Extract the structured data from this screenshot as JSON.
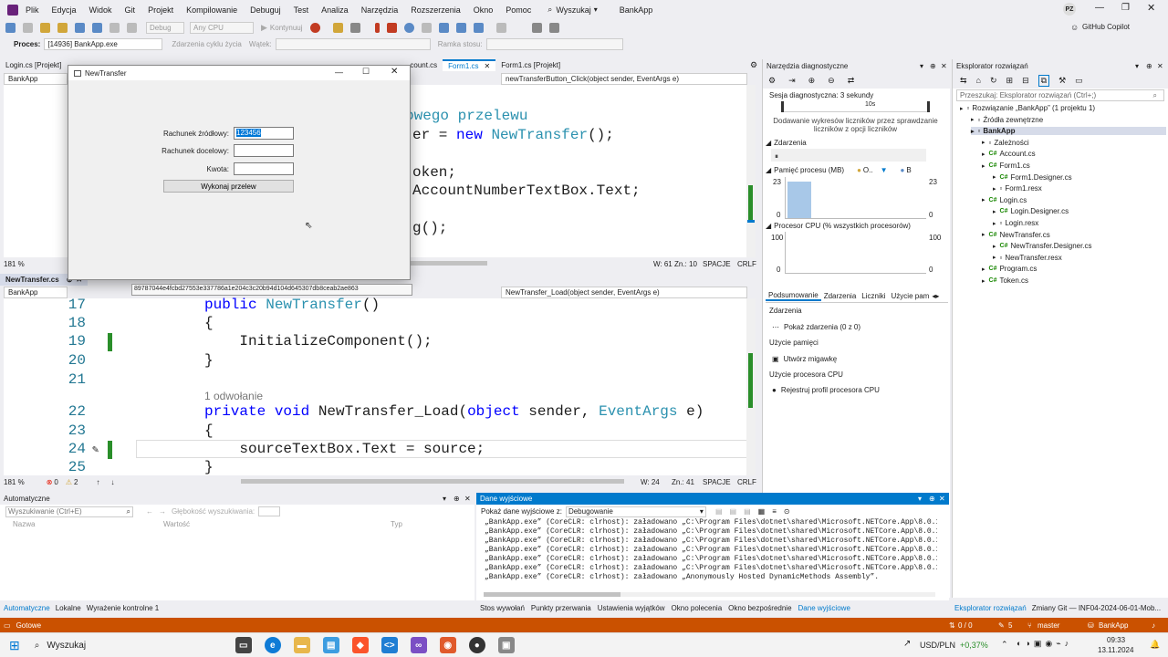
{
  "menu": {
    "items": [
      "Plik",
      "Edycja",
      "Widok",
      "Git",
      "Projekt",
      "Kompilowanie",
      "Debuguj",
      "Test",
      "Analiza",
      "Narzędzia",
      "Rozszerzenia",
      "Okno",
      "Pomoc"
    ],
    "search": "Wyszukaj",
    "solution_name": "BankApp",
    "avatar": "PZ"
  },
  "toolbar": {
    "config": "Debug",
    "platform": "Any CPU",
    "continue": "Kontynuuj",
    "copilot": "GitHub Copilot"
  },
  "process": {
    "label": "Proces:",
    "value": "[14936] BankApp.exe",
    "lifecycle": "Zdarzenia cyklu życia",
    "thread": "Wątek:",
    "frame": "Ramka stosu:"
  },
  "editor_top": {
    "tabs": [
      "Login.cs [Projekt]",
      "Form1.cs",
      "Form1.cs [Projekt]"
    ],
    "tab_partial": "count.cs",
    "project": "BankApp",
    "member": "newTransferButton_Click(object sender, EventArgs e)",
    "lines": [
      {
        "parts": [
          {
            "t": "owego przelewu",
            "c": "ty"
          }
        ]
      },
      {
        "parts": [
          {
            "t": "er = ",
            "c": ""
          },
          {
            "t": "new",
            "c": "kw"
          },
          {
            "t": " ",
            "c": ""
          },
          {
            "t": "NewTransfer",
            "c": "ty"
          },
          {
            "t": "();",
            "c": ""
          }
        ]
      },
      {
        "parts": [
          {
            "t": "oken;",
            "c": ""
          }
        ]
      },
      {
        "parts": [
          {
            "t": "AccountNumberTextBox.Text;",
            "c": ""
          }
        ]
      },
      {
        "parts": [
          {
            "t": "g();",
            "c": ""
          }
        ]
      }
    ],
    "zoom": "181 %",
    "pos_line": "W: 61",
    "pos_col": "Zn.: 10",
    "spaces": "SPACJE",
    "eol": "CRLF"
  },
  "editor_bottom": {
    "tab": "NewTransfer.cs",
    "project": "BankApp",
    "member": "NewTransfer_Load(object sender, EventArgs e)",
    "lines": [
      {
        "n": "17",
        "parts": [
          {
            "t": "public ",
            "c": "kw"
          },
          {
            "t": "NewTransfer",
            "c": "ty"
          },
          {
            "t": "()",
            "c": ""
          }
        ]
      },
      {
        "n": "18",
        "parts": [
          {
            "t": "{",
            "c": ""
          }
        ]
      },
      {
        "n": "19",
        "parts": [
          {
            "t": "    InitializeComponent();",
            "c": ""
          }
        ]
      },
      {
        "n": "20",
        "parts": [
          {
            "t": "}",
            "c": ""
          }
        ]
      },
      {
        "n": "21",
        "parts": []
      },
      {
        "n": "22",
        "parts": [
          {
            "t": "private ",
            "c": "kw"
          },
          {
            "t": "void ",
            "c": "kw"
          },
          {
            "t": "NewTransfer_Load(",
            "c": ""
          },
          {
            "t": "object ",
            "c": "kw"
          },
          {
            "t": "sender, ",
            "c": ""
          },
          {
            "t": "EventArgs",
            "c": "ty"
          },
          {
            "t": " e)",
            "c": ""
          }
        ]
      },
      {
        "n": "23",
        "parts": [
          {
            "t": "{",
            "c": ""
          }
        ]
      },
      {
        "n": "24",
        "parts": [
          {
            "t": "    sourceTextBox.Text = source;",
            "c": ""
          }
        ]
      },
      {
        "n": "25",
        "parts": [
          {
            "t": "}",
            "c": ""
          }
        ]
      }
    ],
    "refs": "1 odwołanie",
    "zoom": "181 %",
    "errors": "0",
    "warnings": "2",
    "pos_line": "W: 24",
    "pos_col": "Zn.: 41",
    "spaces": "SPACJE",
    "eol": "CRLF"
  },
  "dialog": {
    "title": "NewTransfer",
    "source_label": "Rachunek źródłowy:",
    "source_value": "123456",
    "target_label": "Rachunek docelowy:",
    "amount_label": "Kwota:",
    "button": "Wykonaj przelew",
    "token": "89787044e4fcbd27553e337786a1e204c3c20b94d104d645307db8ceab2ae863"
  },
  "diagnostics": {
    "title": "Narzędzia diagnostyczne",
    "session": "Sesja diagnostyczna: 3 sekundy",
    "tick": "10s",
    "hint": "Dodawanie wykresów liczników przez sprawdzanie liczników z opcji liczników",
    "events": "Zdarzenia",
    "memory": "Pamięć procesu (MB)",
    "mem_legend_a": "O..",
    "mem_legend_b": "B",
    "mem_max": "23",
    "mem_min": "0",
    "cpu": "Procesor CPU (% wszystkich procesorów)",
    "cpu_max": "100",
    "cpu_min": "0",
    "tabs": [
      "Podsumowanie",
      "Zdarzenia",
      "Liczniki",
      "Użycie pam"
    ],
    "sec_events": "Zdarzenia",
    "show_events": "Pokaż zdarzenia (0 z 0)",
    "sec_mem": "Użycie pamięci",
    "snapshot": "Utwórz migawkę",
    "sec_cpu": "Użycie procesora CPU",
    "record": "Rejestruj profil procesora CPU"
  },
  "solution_explorer": {
    "title": "Eksplorator rozwiązań",
    "search": "Przeszukaj: Eksplorator rozwiązań (Ctrl+;)",
    "items": [
      {
        "label": "Rozwiązanie „BankApp” (1 projektu 1)",
        "indent": 0
      },
      {
        "label": "Źródła zewnętrzne",
        "indent": 1
      },
      {
        "label": "BankApp",
        "indent": 1,
        "bold": true
      },
      {
        "label": "Zależności",
        "indent": 2
      },
      {
        "label": "Account.cs",
        "indent": 2,
        "cs": true
      },
      {
        "label": "Form1.cs",
        "indent": 2,
        "cs": true
      },
      {
        "label": "Form1.Designer.cs",
        "indent": 3,
        "cs": true
      },
      {
        "label": "Form1.resx",
        "indent": 3
      },
      {
        "label": "Login.cs",
        "indent": 2,
        "cs": true
      },
      {
        "label": "Login.Designer.cs",
        "indent": 3,
        "cs": true
      },
      {
        "label": "Login.resx",
        "indent": 3
      },
      {
        "label": "NewTransfer.cs",
        "indent": 2,
        "cs": true
      },
      {
        "label": "NewTransfer.Designer.cs",
        "indent": 3,
        "cs": true
      },
      {
        "label": "NewTransfer.resx",
        "indent": 3
      },
      {
        "label": "Program.cs",
        "indent": 2,
        "cs": true
      },
      {
        "label": "Token.cs",
        "indent": 2,
        "cs": true
      }
    ],
    "bottom_tab": "Eksplorator rozwiązań",
    "git_tab": "Zmiany Git — INF04-2024-06-01-Mob..."
  },
  "autos": {
    "title": "Automatyczne",
    "search": "Wyszukiwanie (Ctrl+E)",
    "depth": "Głębokość wyszukiwania:",
    "cols": [
      "Nazwa",
      "Wartość",
      "Typ"
    ],
    "tabs": [
      "Automatyczne",
      "Lokalne",
      "Wyrażenie kontrolne 1"
    ]
  },
  "output": {
    "title": "Dane wyjściowe",
    "show_from": "Pokaż dane wyjściowe z:",
    "source": "Debugowanie",
    "lines": [
      "„BankApp.exe” (CoreCLR: clrhost): załadowano „C:\\Program Files\\dotnet\\shared\\Microsoft.NETCore.App\\8.0.10\\",
      "„BankApp.exe” (CoreCLR: clrhost): załadowano „C:\\Program Files\\dotnet\\shared\\Microsoft.NETCore.App\\8.0.10\\",
      "„BankApp.exe” (CoreCLR: clrhost): załadowano „C:\\Program Files\\dotnet\\shared\\Microsoft.NETCore.App\\8.0.10\\",
      "„BankApp.exe” (CoreCLR: clrhost): załadowano „C:\\Program Files\\dotnet\\shared\\Microsoft.NETCore.App\\8.0.10\\",
      "„BankApp.exe” (CoreCLR: clrhost): załadowano „C:\\Program Files\\dotnet\\shared\\Microsoft.NETCore.App\\8.0.10\\",
      "„BankApp.exe” (CoreCLR: clrhost): załadowano „C:\\Program Files\\dotnet\\shared\\Microsoft.NETCore.App\\8.0.10\\",
      "„BankApp.exe” (CoreCLR: clrhost): załadowano „Anonymously Hosted DynamicMethods Assembly”."
    ],
    "tabs": [
      "Stos wywołań",
      "Punkty przerwania",
      "Ustawienia wyjątków",
      "Okno polecenia",
      "Okno bezpośrednie",
      "Dane wyjściowe"
    ]
  },
  "statusbar": {
    "ready": "Gotowe",
    "git_updown": "0 / 0",
    "changes": "5",
    "branch": "master",
    "repo": "BankApp"
  },
  "taskbar": {
    "search": "Wyszukaj",
    "currency": "USD/PLN",
    "change": "+0,37%",
    "time": "09:33",
    "date": "13.11.2024"
  },
  "colors": {
    "accent": "#007acc",
    "status_bg": "#ca5100",
    "keyword": "#0000ff",
    "type": "#2b91af"
  }
}
